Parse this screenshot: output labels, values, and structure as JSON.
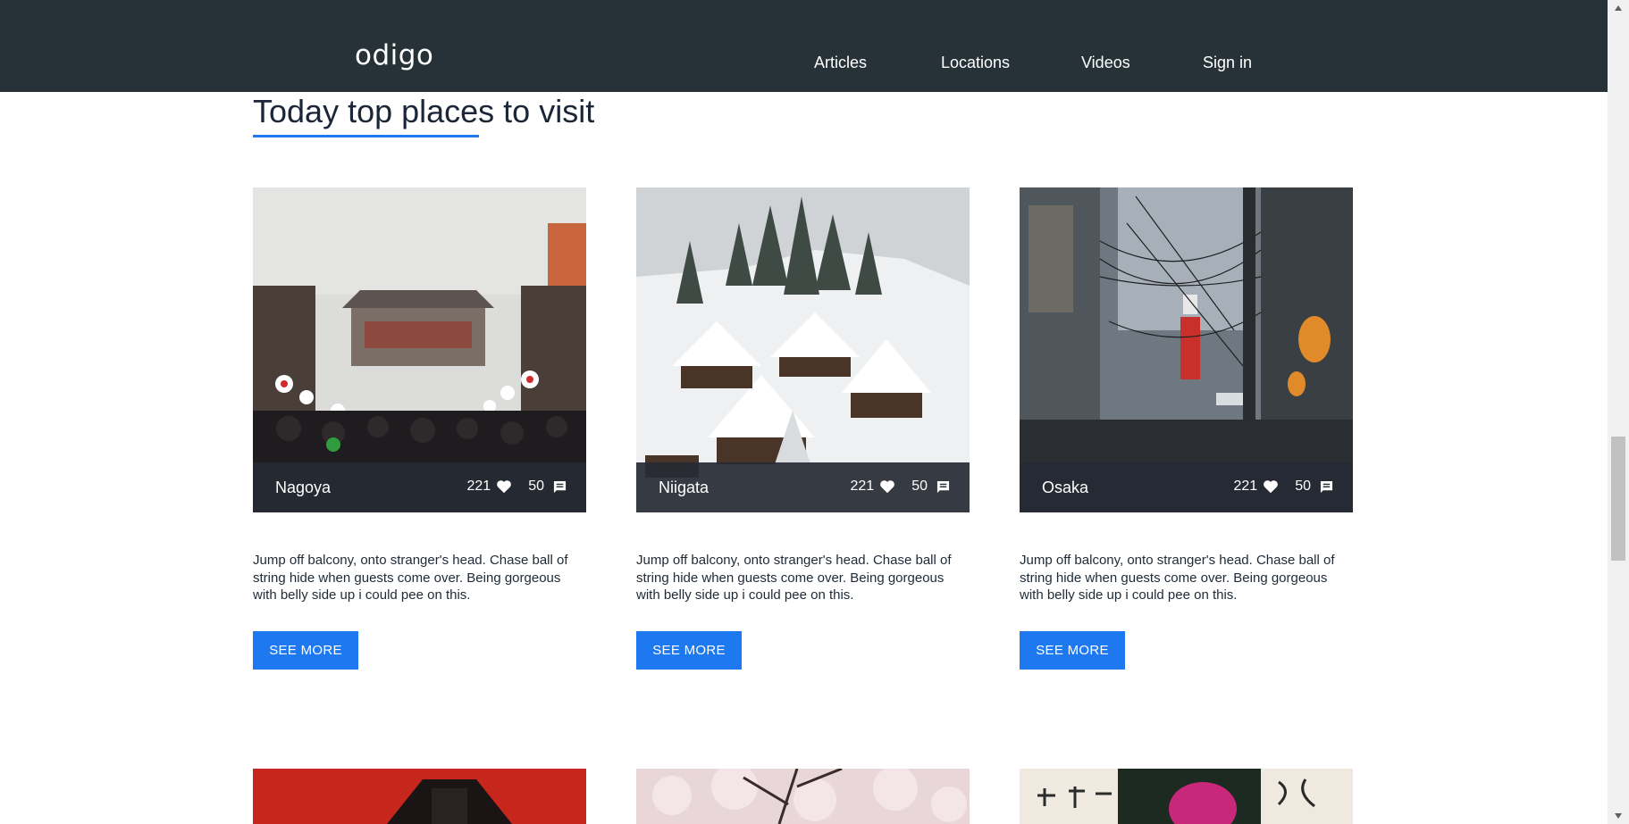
{
  "header": {
    "logo": "odigo",
    "nav": {
      "articles": "Articles",
      "locations": "Locations",
      "videos": "Videos",
      "sign_in": "Sign in"
    }
  },
  "main": {
    "title": "Today top places to visit",
    "cards": [
      {
        "city": "Nagoya",
        "likes": "221",
        "comments": "50",
        "description": "Jump off balcony, onto stranger's head. Chase ball of string hide when guests come over. Being gorgeous with belly side up i could pee on this.",
        "button": "SEE MORE"
      },
      {
        "city": "Niigata",
        "likes": "221",
        "comments": "50",
        "description": "Jump off balcony, onto stranger's head. Chase ball of string hide when guests come over. Being gorgeous with belly side up i could pee on this.",
        "button": "SEE MORE"
      },
      {
        "city": "Osaka",
        "likes": "221",
        "comments": "50",
        "description": "Jump off balcony, onto stranger's head. Chase ball of string hide when guests come over. Being gorgeous with belly side up i could pee on this.",
        "button": "SEE MORE"
      }
    ]
  },
  "colors": {
    "header_bg": "#263238",
    "accent": "#1e78f0",
    "overlay": "#262a34"
  },
  "icons": {
    "likes": "heart-icon",
    "comments": "comment-icon"
  }
}
